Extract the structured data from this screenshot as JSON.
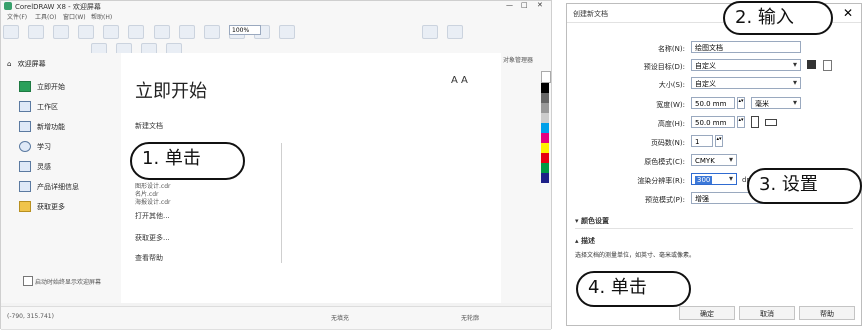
{
  "app": {
    "title": "CorelDRAW X8 - 欢迎屏幕",
    "menu": [
      "文件(F)",
      "工具(O)",
      "窗口(W)",
      "帮助(H)"
    ],
    "zoom": "100%",
    "welcome_tab": "欢迎屏幕",
    "nav": [
      "立即开始",
      "工作区",
      "新增功能",
      "学习",
      "灵感",
      "产品详细信息",
      "获取更多"
    ],
    "page_title": "立即开始",
    "new_doc": "新建文档",
    "recent": [
      "图形设计.cdr",
      "名片.cdr",
      "海报设计.cdr"
    ],
    "open_other": "打开其他...",
    "get_more": "获取更多...",
    "check_updates": "查看帮助",
    "show_on_start": "启动时始终显示欢迎屏幕",
    "status_coords": "(-790, 315.741)",
    "status_none": "无填充",
    "status_none2": "无轮廓",
    "object_manager": "对象管理器"
  },
  "dialog": {
    "title": "创建新文档",
    "name_label": "名称(N):",
    "name_value": "绘图文档",
    "preset_label": "预设目标(D):",
    "preset_value": "自定义",
    "size_label": "大小(S):",
    "size_value": "自定义",
    "width_label": "宽度(W):",
    "width_value": "50.0 mm",
    "unit_value": "毫米",
    "height_label": "高度(H):",
    "height_value": "50.0 mm",
    "pages_label": "页码数(N):",
    "pages_value": "1",
    "color_mode_label": "原色模式(C):",
    "color_mode_value": "CMYK",
    "resolution_label": "渲染分辨率(R):",
    "resolution_value": "300",
    "resolution_unit": "dpi",
    "preview_label": "预览模式(P):",
    "preview_value": "增强",
    "color_settings": "颜色设置",
    "description_title": "描述",
    "description_text": "选择文档的测量单位，如英寸、毫米或像素。",
    "ok": "确定",
    "cancel": "取消",
    "help": "帮助"
  },
  "callouts": {
    "c1": "1. 单击",
    "c2": "2. 输入",
    "c3": "3. 设置",
    "c4": "4. 单击"
  },
  "colors": {
    "accent": "#2f6bd1",
    "selection": "#3c78d8"
  }
}
